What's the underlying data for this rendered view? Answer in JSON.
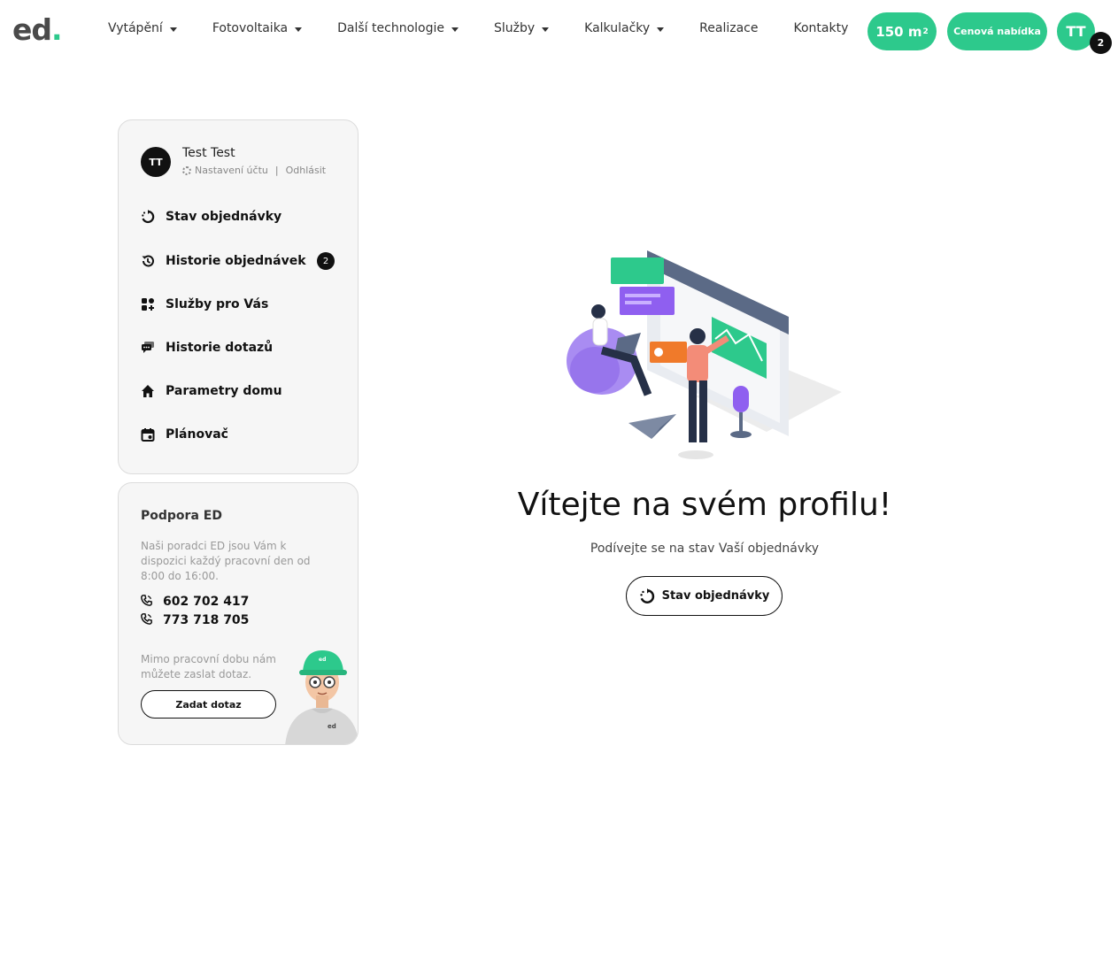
{
  "header": {
    "logo_text": "ed",
    "logo_dot": ".",
    "nav": [
      {
        "label": "Vytápění",
        "has_dropdown": true
      },
      {
        "label": "Fotovoltaika",
        "has_dropdown": true
      },
      {
        "label": "Další technologie",
        "has_dropdown": true
      },
      {
        "label": "Služby",
        "has_dropdown": true
      },
      {
        "label": "Kalkulačky",
        "has_dropdown": true
      },
      {
        "label": "Realizace",
        "has_dropdown": false
      },
      {
        "label": "Kontakty",
        "has_dropdown": false
      }
    ],
    "area_label": "150 m",
    "area_unit_sup": "2",
    "offer_label": "Cenová nabídka",
    "avatar_initials": "TT",
    "notification_count": "2"
  },
  "sidebar": {
    "user": {
      "initials": "TT",
      "name": "Test Test",
      "settings_label": "Nastavení účtu",
      "separator": "|",
      "logout_label": "Odhlásit"
    },
    "menu": [
      {
        "label": "Stav objednávky",
        "icon": "order-status-icon"
      },
      {
        "label": "Historie objednávek",
        "icon": "history-icon",
        "badge": "2"
      },
      {
        "label": "Služby pro Vás",
        "icon": "services-grid-icon"
      },
      {
        "label": "Historie dotazů",
        "icon": "chat-icon"
      },
      {
        "label": "Parametry domu",
        "icon": "home-icon"
      },
      {
        "label": "Plánovač",
        "icon": "calendar-icon"
      }
    ]
  },
  "support": {
    "title": "Podpora ED",
    "text": "Naši poradci ED jsou Vám k dispozici každý pracovní den od 8:00 do 16:00.",
    "phones": [
      "602 702 417",
      "773 718 705"
    ],
    "after_hours_text": "Mimo pracovní dobu nám můžete zaslat dotaz.",
    "ask_button": "Zadat dotaz",
    "helmet_label": "ed",
    "hoodie_label": "ed"
  },
  "main": {
    "welcome_title": "Vítejte na svém profilu!",
    "subtitle": "Podívejte se na stav Vaší objednávky",
    "status_button": "Stav objednávky"
  },
  "colors": {
    "accent": "#2dc98c",
    "dark": "#111111",
    "card_bg": "#f6f6f6"
  }
}
